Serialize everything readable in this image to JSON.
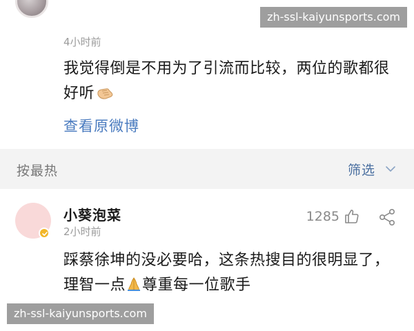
{
  "top_comment": {
    "time": "4小时前",
    "text": "我觉得倒是不用为了引流而比较，两位的歌都很好听",
    "emoji": "hand-emoji",
    "view_original": "查看原微博"
  },
  "sort_bar": {
    "sort_label": "按最热",
    "filter_label": "筛选"
  },
  "comment": {
    "username": "小葵泡菜",
    "time": "2小时前",
    "like_count": "1285",
    "text_before_emoji": "踩蔡徐坤的没必要哈，这条热搜目的很明显了，理智一点",
    "emoji": "pray-emoji",
    "text_after_emoji": "尊重每一位歌手",
    "avatar_badge": "verified-badge"
  },
  "watermarks": {
    "top": "zh-ssl-kaiyunsports.com",
    "bottom": "zh-ssl-kaiyunsports.com"
  },
  "colors": {
    "link": "#4a7bbf",
    "sort_bar_bg": "#f3f3f3",
    "filter": "#4a6fa0",
    "muted_text": "#9b9b9b",
    "avatar_bg": "#f9d9d9",
    "badge": "#f2b72a"
  }
}
